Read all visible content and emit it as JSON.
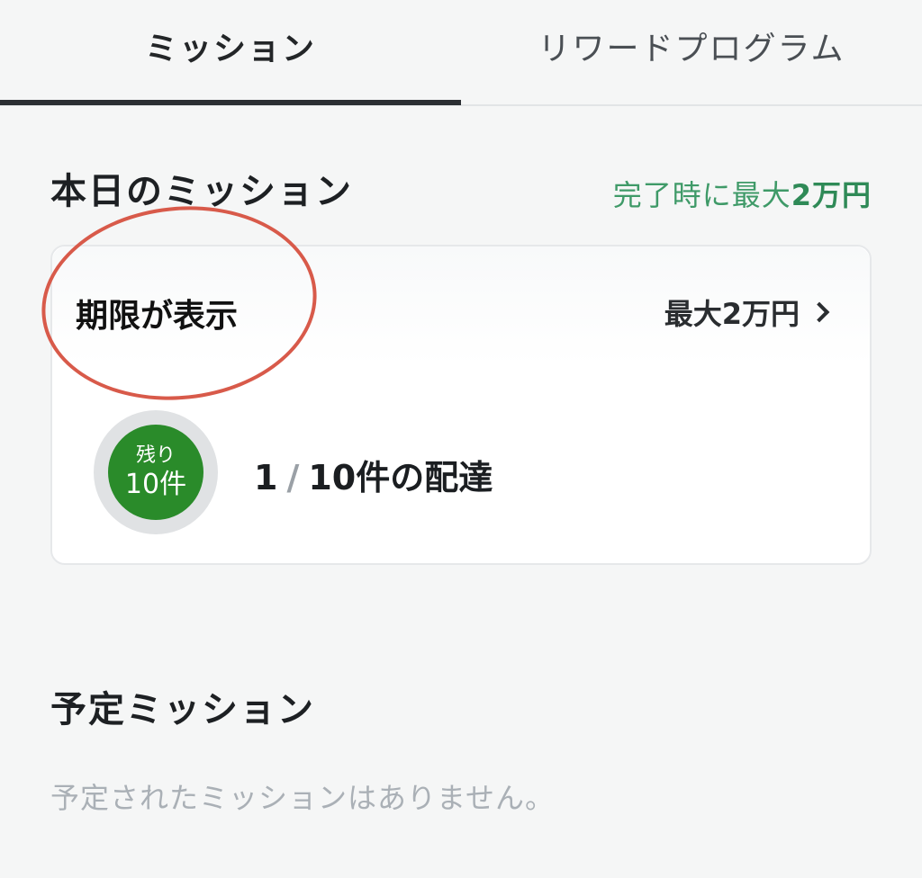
{
  "tabs": [
    {
      "label": "ミッション",
      "active": true
    },
    {
      "label": "リワードプログラム",
      "active": false
    }
  ],
  "today": {
    "title": "本日のミッション",
    "header_reward_prefix": "完了時に最大",
    "header_reward_amount": "2万円"
  },
  "card": {
    "deadline_label": "期限が表示",
    "reward_label": "最大2万円",
    "remaining_label": "残り",
    "remaining_count": "10件",
    "progress_current": "1",
    "progress_separator": "/",
    "progress_total_text": "10件の配達"
  },
  "planned": {
    "title": "予定ミッション",
    "empty_message": "予定されたミッションはありません。"
  },
  "colors": {
    "accent_green": "#2f8a57",
    "badge_green": "#2a8b2a",
    "annotation_red": "#d85a4a"
  }
}
